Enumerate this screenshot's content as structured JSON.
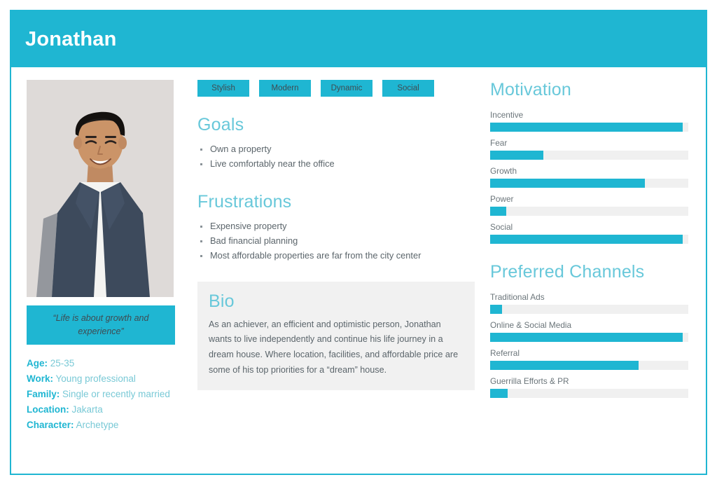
{
  "header": {
    "name": "Jonathan"
  },
  "photo": {
    "alt": "portrait-of-smiling-young-man-in-navy-blazer"
  },
  "tags": [
    "Stylish",
    "Modern",
    "Dynamic",
    "Social"
  ],
  "goals": {
    "heading": "Goals",
    "items": [
      "Own a property",
      "Live comfortably near the office"
    ]
  },
  "frustrations": {
    "heading": "Frustrations",
    "items": [
      "Expensive property",
      "Bad financial planning",
      "Most affordable properties are far from the city center"
    ]
  },
  "bio": {
    "heading": "Bio",
    "paragraph": "As an achiever, an efficient and optimistic person, Jonathan wants to live independently and continue his life journey in a dream house.\nWhere location, facilities, and affordable price are some of his top priorities for a “dream” house."
  },
  "quote": {
    "text": "“Life is about growth and experience”"
  },
  "demographics": [
    {
      "key": "Age:",
      "value": "25-35"
    },
    {
      "key": "Work:",
      "value": "Young professional"
    },
    {
      "key": "Family:",
      "value": "Single or recently married"
    },
    {
      "key": "Location:",
      "value": "Jakarta"
    },
    {
      "key": "Character:",
      "value": "Archetype"
    }
  ],
  "chart_data": [
    {
      "type": "bar",
      "title": "Motivation",
      "orientation": "horizontal",
      "categories": [
        "Incentive",
        "Fear",
        "Growth",
        "Power",
        "Social"
      ],
      "values": [
        97,
        27,
        78,
        8,
        97
      ],
      "ylim": [
        0,
        100
      ],
      "grid": false,
      "legend": "none",
      "xlabel": "",
      "ylabel": ""
    },
    {
      "type": "bar",
      "title": "Preferred Channels",
      "orientation": "horizontal",
      "categories": [
        "Traditional Ads",
        "Online & Social Media",
        "Referral",
        "Guerrilla Efforts & PR"
      ],
      "values": [
        6,
        97,
        75,
        9
      ],
      "ylim": [
        0,
        100
      ],
      "grid": false,
      "legend": "none",
      "xlabel": "",
      "ylabel": ""
    }
  ],
  "colors": {
    "brand": "#1fb6d2",
    "heading": "#68c8da",
    "track": "#f0f0f0",
    "bio_bg": "#f1f1f1",
    "body_text": "#5b656b"
  }
}
